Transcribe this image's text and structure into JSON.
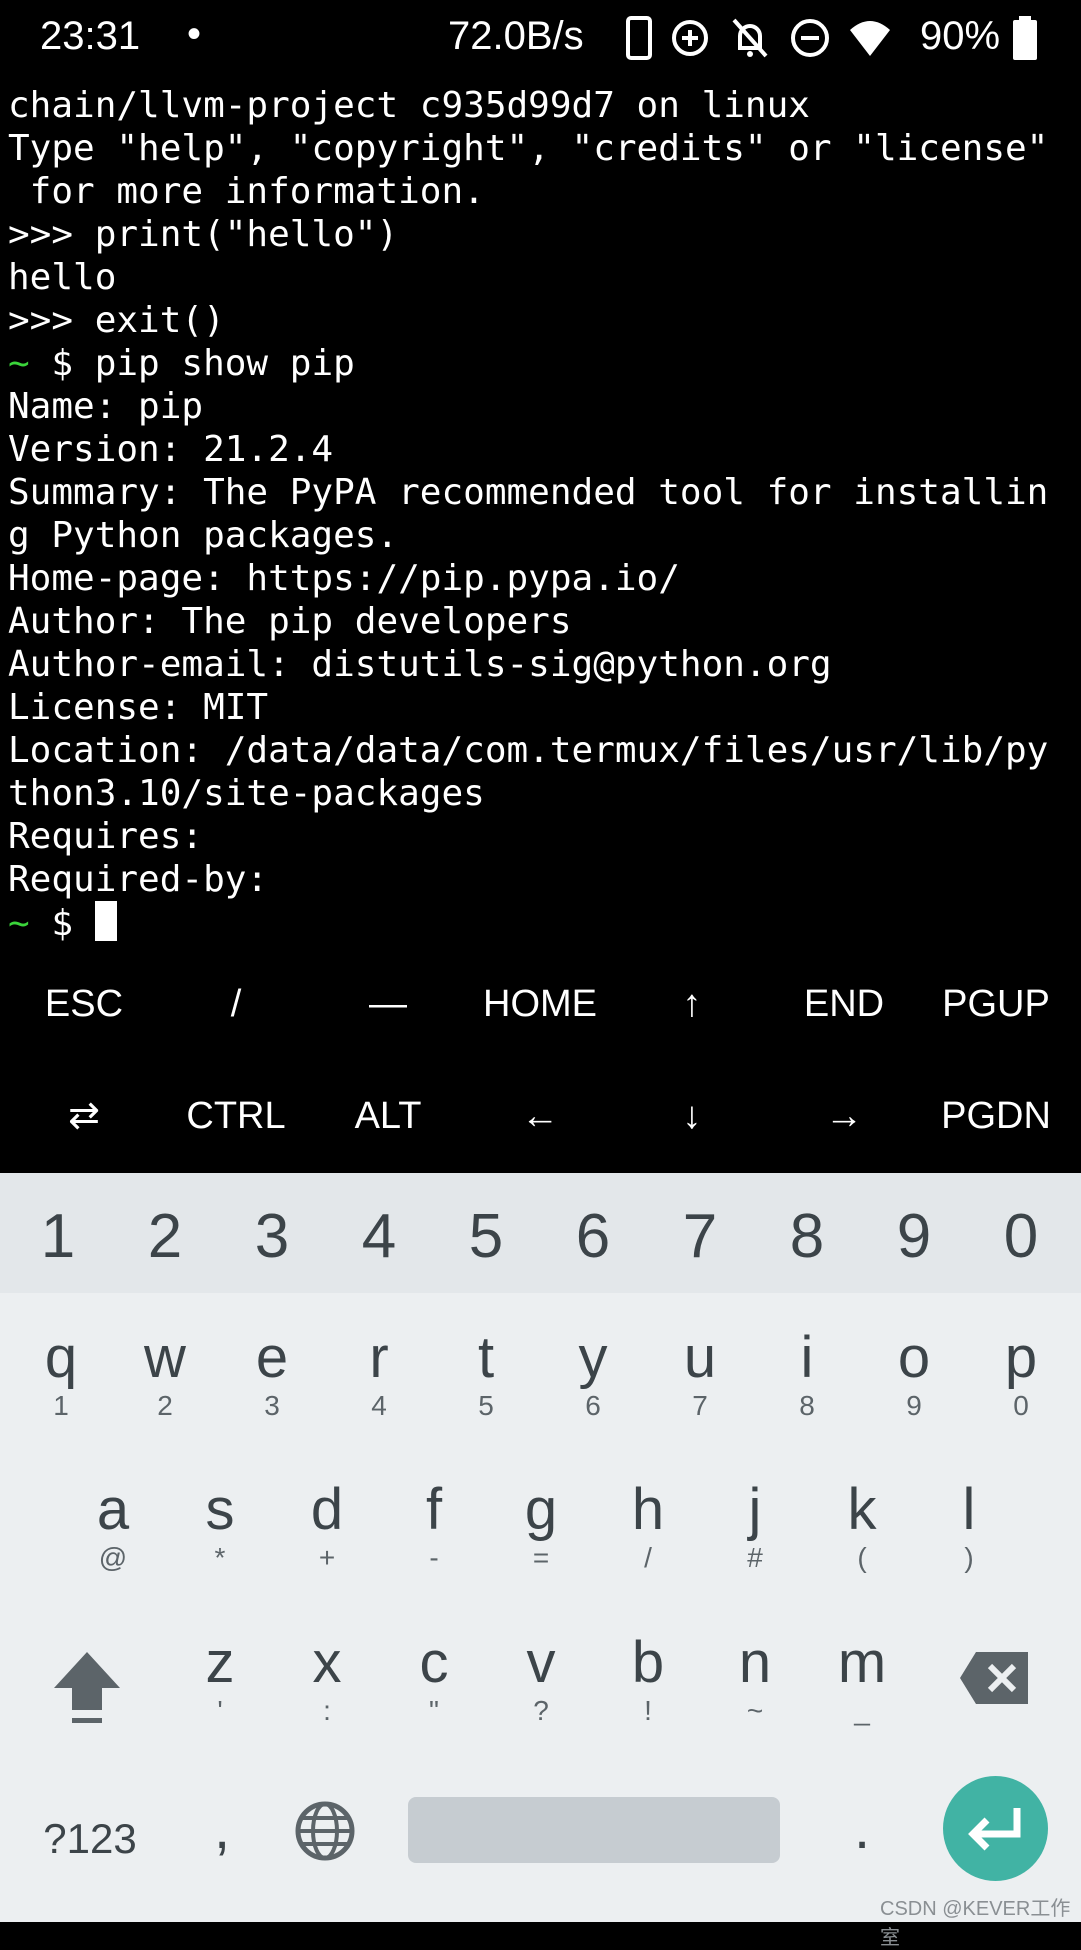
{
  "status_bar": {
    "time": "23:31",
    "dot": "•",
    "speed": "72.0B/s",
    "battery": "90%",
    "icons": [
      "phone-icon",
      "data-saver-icon",
      "bell-off-icon",
      "dnd-icon",
      "wifi-icon",
      "battery-icon"
    ]
  },
  "terminal": {
    "lines": [
      "chain/llvm-project c935d99d7 on linux",
      "Type \"help\", \"copyright\", \"credits\" or \"license\"",
      " for more information.",
      ">>> print(\"hello\")",
      "hello",
      ">>> exit()",
      "Name: pip",
      "Version: 21.2.4",
      "Summary: The PyPA recommended tool for installin",
      "g Python packages.",
      "Home-page: https://pip.pypa.io/",
      "Author: The pip developers",
      "Author-email: distutils-sig@python.org",
      "License: MIT",
      "Location: /data/data/com.termux/files/usr/lib/py",
      "thon3.10/site-packages",
      "Requires:",
      "Required-by:"
    ],
    "prompt_tilde": "~",
    "prompt_cmd": " $ pip show pip",
    "prompt_final": " $ "
  },
  "extra_keys": {
    "row1": [
      "ESC",
      "/",
      "—",
      "HOME",
      "↑",
      "END",
      "PGUP"
    ],
    "row2": [
      "⇄",
      "CTRL",
      "ALT",
      "←",
      "↓",
      "→",
      "PGDN"
    ]
  },
  "keyboard": {
    "numbers": [
      "1",
      "2",
      "3",
      "4",
      "5",
      "6",
      "7",
      "8",
      "9",
      "0"
    ],
    "row1": [
      {
        "k": "q",
        "s": "1"
      },
      {
        "k": "w",
        "s": "2"
      },
      {
        "k": "e",
        "s": "3"
      },
      {
        "k": "r",
        "s": "4"
      },
      {
        "k": "t",
        "s": "5"
      },
      {
        "k": "y",
        "s": "6"
      },
      {
        "k": "u",
        "s": "7"
      },
      {
        "k": "i",
        "s": "8"
      },
      {
        "k": "o",
        "s": "9"
      },
      {
        "k": "p",
        "s": "0"
      }
    ],
    "row2": [
      {
        "k": "a",
        "s": "@"
      },
      {
        "k": "s",
        "s": "*"
      },
      {
        "k": "d",
        "s": "+"
      },
      {
        "k": "f",
        "s": "-"
      },
      {
        "k": "g",
        "s": "="
      },
      {
        "k": "h",
        "s": "/"
      },
      {
        "k": "j",
        "s": "#"
      },
      {
        "k": "k",
        "s": "("
      },
      {
        "k": "l",
        "s": ")"
      }
    ],
    "row3": [
      {
        "k": "z",
        "s": "'"
      },
      {
        "k": "x",
        "s": ":"
      },
      {
        "k": "c",
        "s": "\""
      },
      {
        "k": "v",
        "s": "?"
      },
      {
        "k": "b",
        "s": "!"
      },
      {
        "k": "n",
        "s": "~"
      },
      {
        "k": "m",
        "s": "_"
      }
    ],
    "symbols_label": "?123",
    "comma": ",",
    "period": "."
  },
  "watermark": "CSDN @KEVER工作室"
}
